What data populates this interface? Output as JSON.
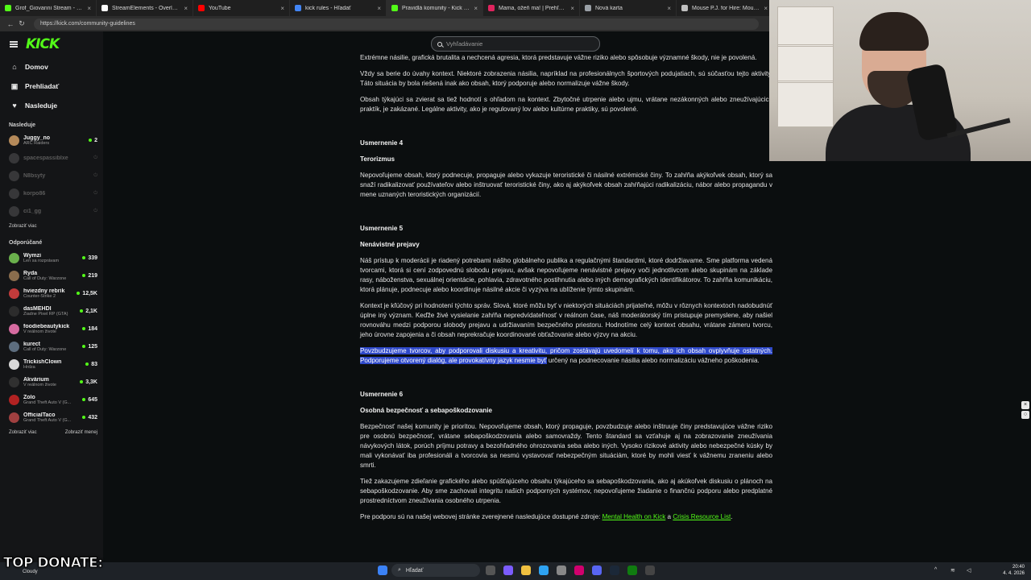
{
  "browser": {
    "tabs": [
      {
        "title": "Grof_Giovanni Stream - Kick Dash",
        "color": "#53fc18",
        "active": false
      },
      {
        "title": "StreamElements - Overlays",
        "color": "#ffffff",
        "active": false
      },
      {
        "title": "YouTube",
        "color": "#ff0000",
        "active": false
      },
      {
        "title": "kick rules - Hľadať",
        "color": "#4285f4",
        "active": false
      },
      {
        "title": "Pravidlá komunity - Kick Streamin",
        "color": "#53fc18",
        "active": true
      },
      {
        "title": "Mama, ožeň ma! | Prehľad | Archi",
        "color": "#e0245e",
        "active": false
      },
      {
        "title": "Nová karta",
        "color": "#9aa0a6",
        "active": false
      },
      {
        "title": "Mouse P.J. for Hire: Mouseburg",
        "color": "#c0c0c0",
        "active": false
      }
    ],
    "url": "https://kick.com/community-guidelines"
  },
  "sidebar": {
    "logo": "KICK",
    "nav": [
      {
        "label": "Domov",
        "icon": "home-icon",
        "glyph": "⌂"
      },
      {
        "label": "Prehliadať",
        "icon": "browse-icon",
        "glyph": "▣"
      },
      {
        "label": "Nasleduje",
        "icon": "heart-icon",
        "glyph": "♥"
      }
    ],
    "following_title": "Nasleduje",
    "following": [
      {
        "name": "Juggy_no",
        "category": "ARC Raiders",
        "viewers": "2",
        "color": "#b58a5a",
        "online": true
      },
      {
        "name": "spacespassiblxe",
        "category": "",
        "viewers": "",
        "color": "#777777",
        "online": false
      },
      {
        "name": "N8bsyty",
        "category": "",
        "viewers": "",
        "color": "#777777",
        "online": false
      },
      {
        "name": "korpo86",
        "category": "",
        "viewers": "",
        "color": "#777777",
        "online": false
      },
      {
        "name": "ci1_gg",
        "category": "",
        "viewers": "",
        "color": "#777777",
        "online": false
      }
    ],
    "show_more": "Zobraziť viac",
    "recommended_title": "Odporúčané",
    "recommended": [
      {
        "name": "Wymzi",
        "category": "Len sa rozprávam",
        "viewers": "339",
        "color": "#6ab04c"
      },
      {
        "name": "Ryda",
        "category": "Call of Duty: Warzone",
        "viewers": "219",
        "color": "#8a6d4d"
      },
      {
        "name": "hviezdny rebrik",
        "category": "Counter-Strike 2",
        "viewers": "12,5K",
        "color": "#c23b3b"
      },
      {
        "name": "dasMEHDI",
        "category": "Žiadne Pixel RP (GTA)",
        "viewers": "2,1K",
        "color": "#2c2c2c"
      },
      {
        "name": "foodiebeautykick",
        "category": "V reálnom živote",
        "viewers": "184",
        "color": "#d66ba0"
      },
      {
        "name": "kurect",
        "category": "Call of Duty: Warzone",
        "viewers": "125",
        "color": "#5d6d7e"
      },
      {
        "name": "TrickishClown",
        "category": "Hrdza",
        "viewers": "83",
        "color": "#d9d9d9"
      },
      {
        "name": "Akvárium",
        "category": "V reálnom živote",
        "viewers": "3,3K",
        "color": "#303030"
      },
      {
        "name": "Zolo",
        "category": "Grand Theft Auto V (G...",
        "viewers": "645",
        "color": "#b22222"
      },
      {
        "name": "OfficialTaco",
        "category": "Grand Theft Auto V (G...",
        "viewers": "432",
        "color": "#a04040"
      }
    ],
    "show_more2": "Zobraziť viac",
    "show_less": "Zobraziť menej"
  },
  "search": {
    "placeholder": "Vyhľadávanie"
  },
  "article": {
    "p1": "Extrémne násilie, grafická brutalita a nechcená agresia, ktorá predstavuje vážne riziko alebo spôsobuje významné škody, nie je povolená.",
    "p2": "Vždy sa berie do úvahy kontext. Niektoré zobrazenia násilia, napríklad na profesionálnych športových podujatiach, sú súčasťou tejto aktivity. Táto situácia by bola riešená inak ako obsah, ktorý podporuje alebo normalizuje vážne škody.",
    "p3": "Obsah týkajúci sa zvierat sa tiež hodnotí s ohľadom na kontext. Zbytočné utrpenie alebo ujmu, vrátane nezákonných alebo zneužívajúcich praktík, je zakázané. Legálne aktivity, ako je regulovaný lov alebo kultúrne praktiky, sú povolené.",
    "r4_num": "Usmernenie 4",
    "r4_title": "Terorizmus",
    "r4_p1": "Nepovoľujeme obsah, ktorý podnecuje, propaguje alebo vykazuje teroristické či násilné extrémické činy. To zahŕňa akýkoľvek obsah, ktorý sa snaží radikalizovať používateľov alebo inštruovať teroristické činy, ako aj akýkoľvek obsah zahŕňajúci radikalizáciu, nábor alebo propagandu v mene uznaných teroristických organizácií.",
    "r5_num": "Usmernenie 5",
    "r5_title": "Nenávistné prejavy",
    "r5_p1": "Náš prístup k moderácii je riadený potrebami nášho globálneho publika a regulačnými štandardmi, ktoré dodržiavame. Sme platforma vedená tvorcami, ktorá si cení zodpovednú slobodu prejavu, avšak nepovoľujeme nenávistné prejavy voči jednotlivcom alebo skupinám na základe rasy, náboženstva, sexuálnej orientácie, pohlavia, zdravotného postihnutia alebo iných demografických identifikátorov. To zahŕňa komunikáciu, ktorá plánuje, podnecuje alebo koordinuje násilné akcie či vyzýva na ublíženie týmto skupinám.",
    "r5_p2": "Kontext je kľúčový pri hodnotení týchto správ. Slová, ktoré môžu byť v niektorých situáciách prijateľné, môžu v rôznych kontextoch nadobudnúť úplne iný význam. Keďže živé vysielanie zahŕňa nepredvídateľnosť v reálnom čase, náš moderátorský tím pristupuje premyslene, aby našiel rovnováhu medzi podporou slobody prejavu a udržiavaním bezpečného priestoru. Hodnotíme celý kontext obsahu, vrátane zámeru tvorcu, jeho úrovne zapojenia a či obsah neprekračuje koordinované obťažovanie alebo výzvy na akciu.",
    "r5_p3_highlight": "Povzbudzujeme tvorcov, aby podporovali diskusiu a kreativitu, pričom zostávajú uvedomelí k tomu, ako ich obsah ovplyvňuje ostatných. Podporujeme otvorený dialóg, ale provokatívny jazyk nesmie byť",
    "r5_p3_rest": " určený na podnecovanie násilia alebo normalizáciu vážneho poškodenia.",
    "r6_num": "Usmernenie 6",
    "r6_title": "Osobná bezpečnosť a sebapoškodzovanie",
    "r6_p1": "Bezpečnosť našej komunity je prioritou. Nepovoľujeme obsah, ktorý propaguje, povzbudzuje alebo inštruuje činy predstavujúce vážne riziko pre osobnú bezpečnosť, vrátane sebapoškodzovania alebo samovraždy. Tento štandard sa vzťahuje aj na zobrazovanie zneužívania návykových látok, porúch príjmu potravy a bezohľadného ohrozovania seba alebo iných. Vysoko rizikové aktivity alebo nebezpečné kúsky by mali vykonávať iba profesionáli a tvorcovia sa nesmú vystavovať nebezpečným situáciám, ktoré by mohli viesť k vážnemu zraneniu alebo smrti.",
    "r6_p2": "Tiež zakazujeme zdieľanie grafického alebo spúšťajúceho obsahu týkajúceho sa sebapoškodzovania, ako aj akúkoľvek diskusiu o plánoch na sebapoškodzovanie. Aby sme zachovali integritu našich podporných systémov, nepovoľujeme žiadanie o finančnú podporu alebo predplatné prostredníctvom zneužívania osobného utrpenia.",
    "r6_p3_prefix": "Pre podporu sú na našej webovej stránke zverejnené nasledujúce dostupné zdroje: ",
    "link1": "Mental Health on Kick",
    "and": " a ",
    "link2": "Crisis Resource List",
    "end": "."
  },
  "overlay": {
    "donate": "TOP DONATE:"
  },
  "taskbar": {
    "weather": "Cloudy",
    "search": "Hľadať",
    "time": "20:40",
    "date": "4. 4. 2026"
  }
}
